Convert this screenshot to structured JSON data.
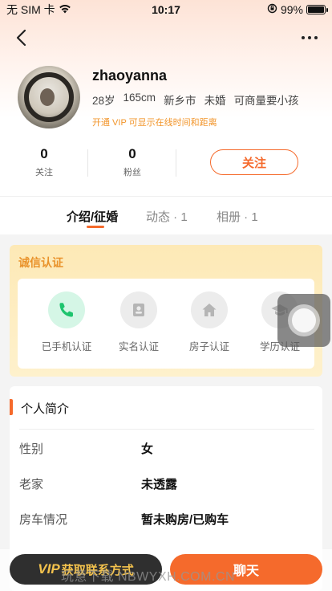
{
  "status_bar": {
    "carrier": "无 SIM 卡",
    "time": "10:17",
    "battery": "99%",
    "battery_level": 0.99
  },
  "profile": {
    "name": "zhaoyanna",
    "meta": [
      "28岁",
      "165cm",
      "新乡市",
      "未婚",
      "可商量要小孩"
    ],
    "vip_tip": "开通 VIP 可显示在线时间和距离"
  },
  "stats": [
    {
      "value": "0",
      "label": "关注"
    },
    {
      "value": "0",
      "label": "粉丝"
    }
  ],
  "follow_button": "关注",
  "tabs": [
    {
      "label": "介绍/征婚"
    },
    {
      "label": "动态 · 1"
    },
    {
      "label": "相册 · 1"
    }
  ],
  "certification": {
    "title": "诚信认证",
    "items": [
      {
        "label": "已手机认证",
        "icon": "phone-icon",
        "verified": true
      },
      {
        "label": "实名认证",
        "icon": "id-card-icon",
        "verified": false
      },
      {
        "label": "房子认证",
        "icon": "house-icon",
        "verified": false
      },
      {
        "label": "学历认证",
        "icon": "graduation-cap-icon",
        "verified": false
      }
    ]
  },
  "intro": {
    "title": "个人简介",
    "rows": [
      {
        "key": "性别",
        "value": "女"
      },
      {
        "key": "老家",
        "value": "未透露"
      },
      {
        "key": "房车情况",
        "value": "暂未购房/已购车"
      }
    ]
  },
  "bottom": {
    "contact_vip": "VIP",
    "contact_label": "获取联系方式",
    "chat_label": "聊天",
    "watermark": "玩意下载 NBWYXH.COM.CN"
  },
  "colors": {
    "accent": "#f56a2c",
    "gold": "#e9922a",
    "verified_bg": "#d5f6e6"
  }
}
